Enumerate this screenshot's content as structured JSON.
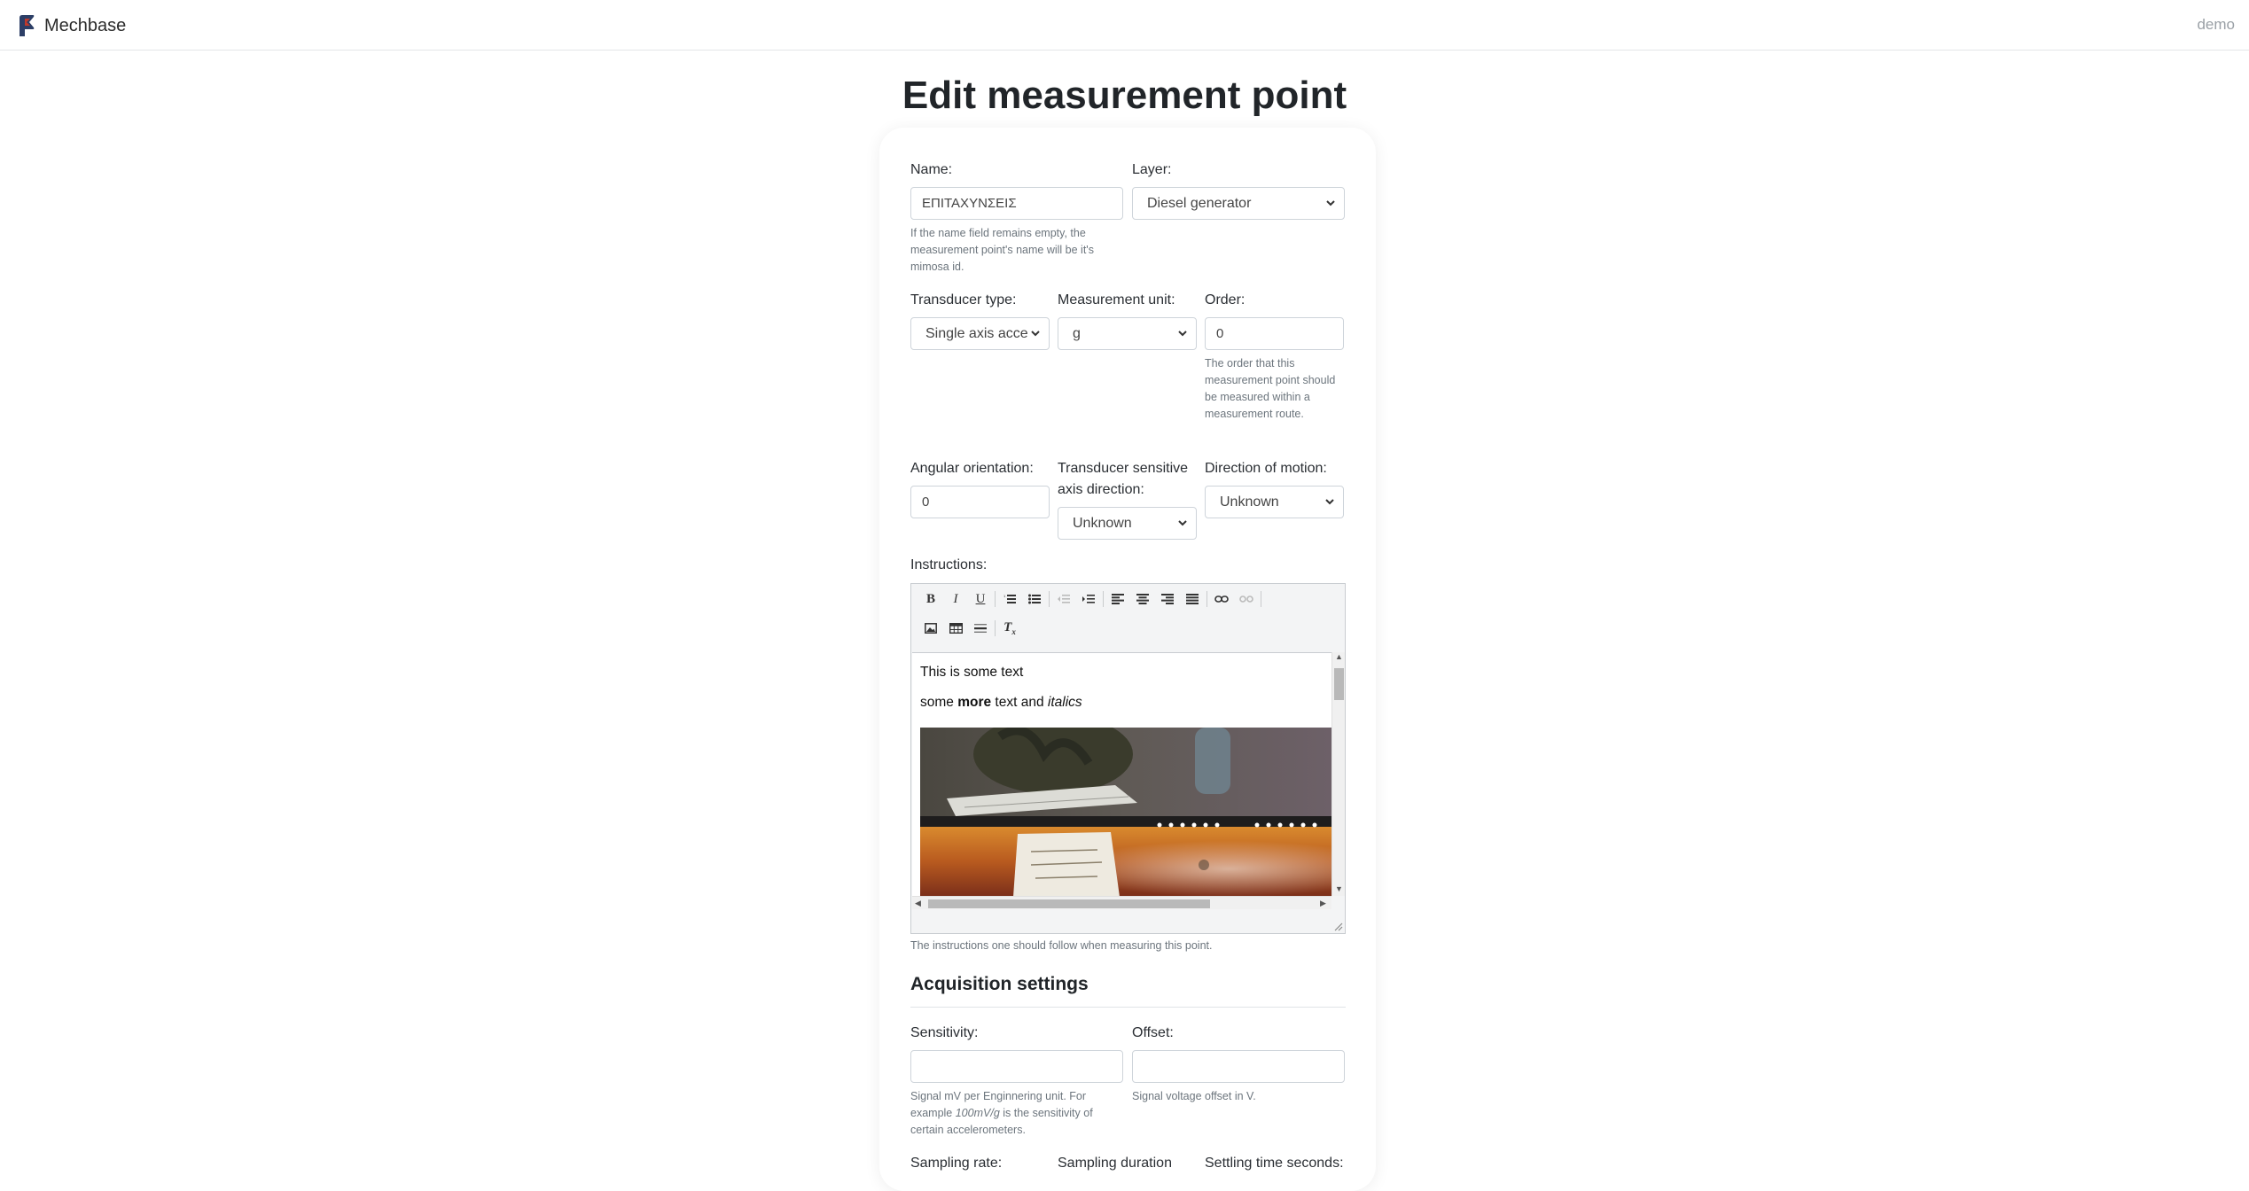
{
  "navbar": {
    "brand": "Mechbase",
    "user": "demo",
    "accent_color": "#c0392b",
    "logo_color": "#2c3e66"
  },
  "page": {
    "title": "Edit measurement point"
  },
  "form": {
    "name": {
      "label": "Name:",
      "value": "ΕΠΙΤΑΧΥΝΣΕΙΣ",
      "help": "If the name field remains empty, the measurement point's name will be it's mimosa id."
    },
    "layer": {
      "label": "Layer:",
      "value": "Diesel generator"
    },
    "transducer_type": {
      "label": "Transducer type:",
      "value": "Single axis acce"
    },
    "measurement_unit": {
      "label": "Measurement unit:",
      "value": "g"
    },
    "order": {
      "label": "Order:",
      "value": "0",
      "help": "The order that this measurement point should be measured within a measurement route."
    },
    "angular_orientation": {
      "label": "Angular orientation:",
      "value": "0"
    },
    "sensitive_axis": {
      "label": "Transducer sensitive axis direction:",
      "value": "Unknown"
    },
    "direction_of_motion": {
      "label": "Direction of motion:",
      "value": "Unknown"
    },
    "instructions": {
      "label": "Instructions:",
      "line1": "This is some text",
      "line2_pre": "some ",
      "line2_bold": "more",
      "line2_mid": " text and ",
      "line2_italic": "italics",
      "help": "The instructions one should follow when measuring this point.",
      "toolbar_row1": [
        "bold-icon",
        "italic-icon",
        "underline-icon",
        "numbered-list-icon",
        "bullet-list-icon",
        "outdent-icon",
        "indent-icon",
        "align-left-icon",
        "align-center-icon",
        "align-right-icon",
        "align-justify-icon",
        "link-icon",
        "unlink-icon"
      ],
      "toolbar_row2": [
        "image-icon",
        "table-icon",
        "horizontal-rule-icon",
        "clear-format-icon"
      ]
    }
  },
  "acquisition": {
    "title": "Acquisition settings",
    "sensitivity": {
      "label": "Sensitivity:",
      "value": "",
      "help_pre": "Signal mV per Enginnering unit. For example ",
      "help_em": "100mV/g",
      "help_post": " is the sensitivity of certain accelerometers."
    },
    "offset": {
      "label": "Offset:",
      "value": "",
      "help": "Signal voltage offset in V."
    },
    "sampling_rate": {
      "label": "Sampling rate:"
    },
    "sampling_duration": {
      "label": "Sampling duration"
    },
    "settling_time": {
      "label": "Settling time seconds:"
    }
  }
}
